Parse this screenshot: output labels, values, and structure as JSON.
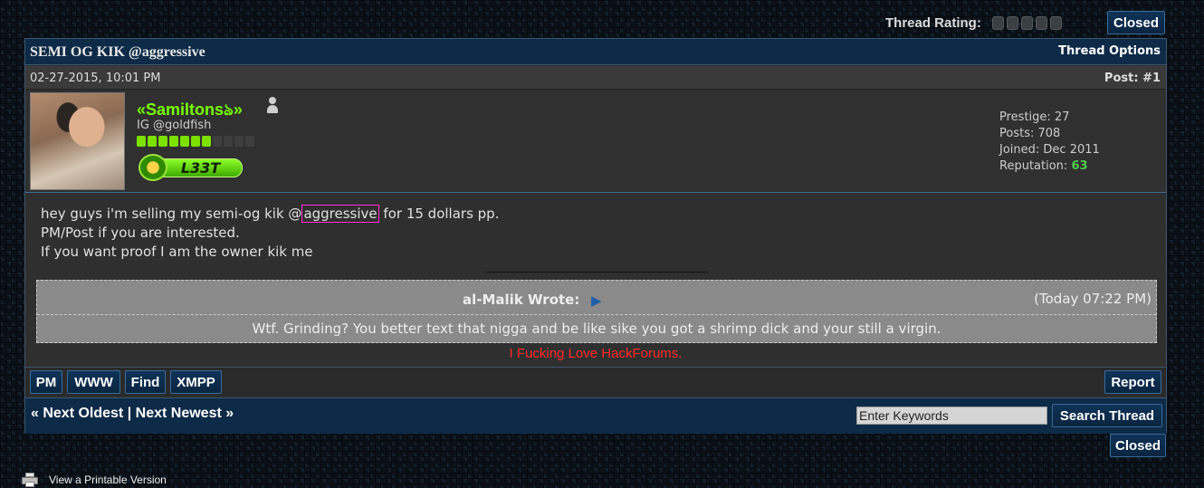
{
  "top_bar": {
    "rating_label": "Thread Rating:",
    "rating_stars": 5,
    "closed_label": "Closed"
  },
  "thread": {
    "title": "SEMI OG KIK @aggressive",
    "options_label": "Thread Options"
  },
  "post": {
    "date": "02-27-2015, 10:01 PM",
    "number": "Post: #1",
    "author": {
      "username": "«Samiltonsঌ»",
      "usertitle": "IG @goldfish",
      "rep_pips_on": 7,
      "rep_pips_total": 11,
      "award_label": "L33T",
      "status_icon": "online-user-icon"
    },
    "stats": {
      "prestige_label": "Prestige:",
      "prestige": "27",
      "posts_label": "Posts:",
      "posts": "708",
      "joined_label": "Joined:",
      "joined": "Dec 2011",
      "reputation_label": "Reputation:",
      "reputation": "63"
    },
    "body": {
      "line1_pre": "hey guys i'm selling my semi-og kik @",
      "line1_link": "aggressive",
      "line1_post": " for 15 dollars pp.",
      "line2": "PM/Post if you are interested.",
      "line3": "If you want proof I am the owner kik me"
    },
    "quote": {
      "author": "al-Malik Wrote:",
      "time": "(Today 07:22 PM)",
      "text": "Wtf. Grinding? You better text that nigga and be like sike you got a shrimp dick and your still a virgin."
    },
    "signature": "I Fucking Love HackForums.",
    "buttons": {
      "pm": "PM",
      "www": "WWW",
      "find": "Find",
      "xmpp": "XMPP",
      "report": "Report"
    }
  },
  "nav": {
    "next_oldest": "« Next Oldest",
    "separator": "|",
    "next_newest": "Next Newest »",
    "search_placeholder": "Enter Keywords",
    "search_button": "Search Thread"
  },
  "bottom": {
    "closed_label": "Closed",
    "printable_label": "View a Printable Version"
  },
  "colors": {
    "accent_blue": "#0d2a47",
    "username_green": "#77ff00",
    "reputation_green": "#4ec94e",
    "signature_red": "#ff2a2a",
    "link_highlight": "#ff2bd5"
  }
}
